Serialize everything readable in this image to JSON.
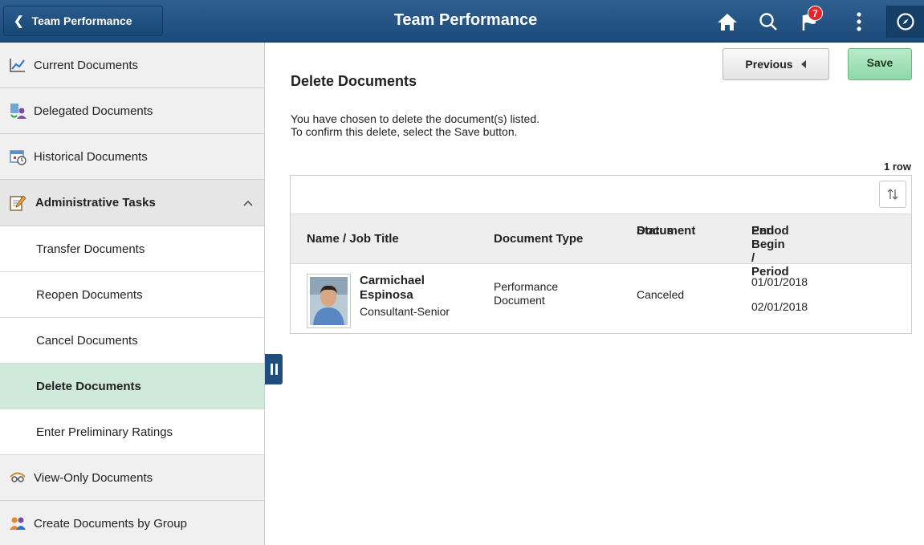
{
  "header": {
    "back_label": "Team Performance",
    "title": "Team Performance",
    "notification_count": "7",
    "icons": [
      "home-icon",
      "search-icon",
      "notifications-flag-icon",
      "actions-menu-icon",
      "navbar-compass-icon"
    ]
  },
  "sidebar": {
    "items": [
      {
        "label": "Current Documents",
        "icon": "line-chart-icon"
      },
      {
        "label": "Delegated Documents",
        "icon": "delegate-people-icon"
      },
      {
        "label": "Historical Documents",
        "icon": "calendar-clock-icon"
      }
    ],
    "group": {
      "label": "Administrative Tasks",
      "icon": "notepad-pencil-icon",
      "expanded": true,
      "subitems": [
        "Transfer Documents",
        "Reopen Documents",
        "Cancel  Documents",
        "Delete Documents",
        "Enter Preliminary Ratings"
      ],
      "active": "Delete Documents"
    },
    "after_items": [
      {
        "label": "View-Only Documents",
        "icon": "view-only-icon"
      },
      {
        "label": "Create Documents by Group",
        "icon": "group-people-icon"
      }
    ]
  },
  "main": {
    "title": "Delete Documents",
    "previous_label": "Previous",
    "save_label": "Save",
    "message_line1": "You have chosen to delete the document(s) listed.",
    "message_line2": "To confirm this delete, select the Save button.",
    "row_count": "1 row",
    "table": {
      "headers": {
        "name": "Name / Job Title",
        "type": "Document Type",
        "status_line1": "Document",
        "status_line2": "Status",
        "period_line1": "Period Begin / Period",
        "period_line2": "End"
      },
      "rows": [
        {
          "name_line1": "Carmichael",
          "name_line2": "Espinosa",
          "job_title": "Consultant-Senior",
          "doc_type_line1": "Performance",
          "doc_type_line2": "Document",
          "status": "Canceled",
          "period_begin": "01/01/2018",
          "period_end": "02/01/2018"
        }
      ]
    }
  },
  "colors": {
    "header": "#1f4e7e",
    "active_item": "#cfe9da",
    "save_button": "#a3e1b8",
    "badge": "#e5252a"
  }
}
